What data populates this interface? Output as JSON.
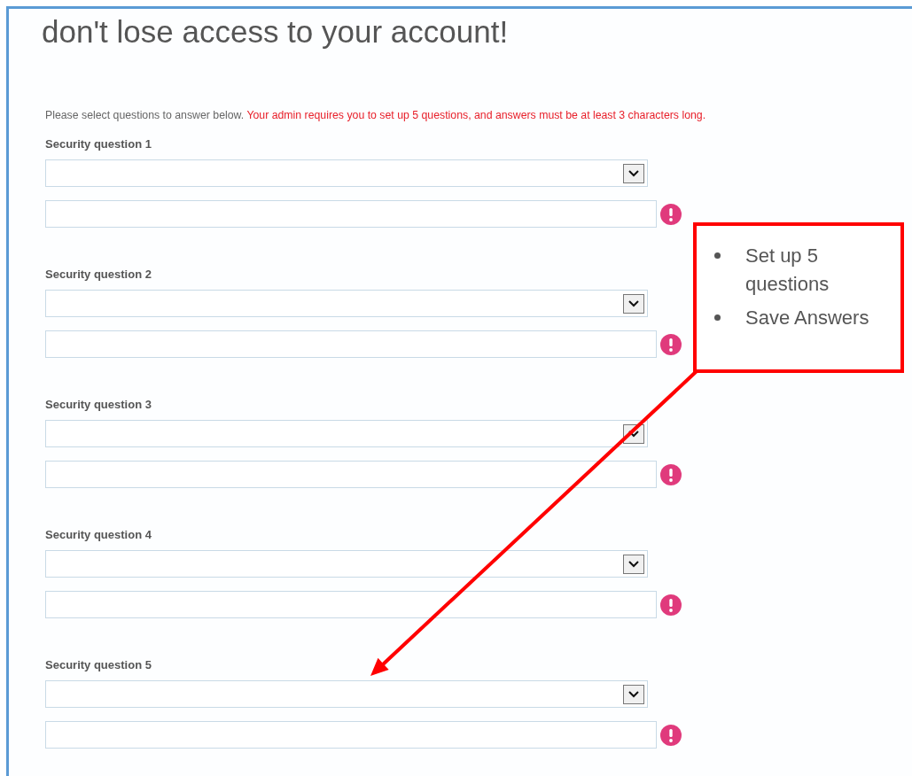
{
  "title": "don't lose access to your account!",
  "intro": {
    "text": "Please select questions to answer below.",
    "requirement": "Your admin requires you to set up 5 questions, and answers must be at least 3 characters long."
  },
  "questions": [
    {
      "label": "Security question 1",
      "error": true
    },
    {
      "label": "Security question 2",
      "error": true
    },
    {
      "label": "Security question 3",
      "error": true
    },
    {
      "label": "Security question 4",
      "error": true
    },
    {
      "label": "Security question 5",
      "error": true
    }
  ],
  "callout": {
    "items": [
      "Set up 5 questions",
      "Save Answers"
    ]
  }
}
